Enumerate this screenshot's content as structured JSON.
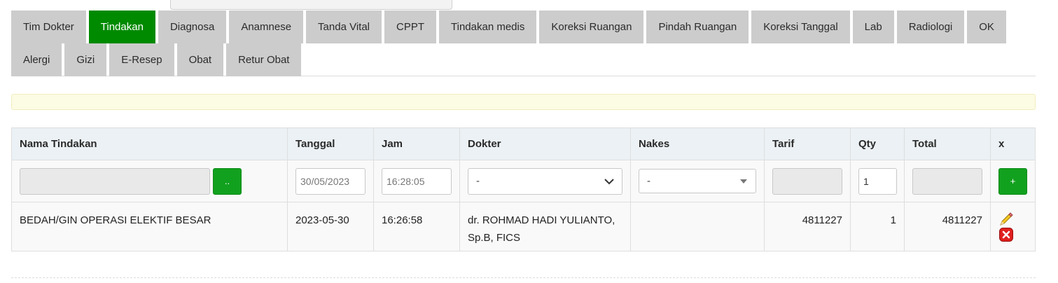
{
  "tabs_row1": [
    "Tim Dokter",
    "Tindakan",
    "Diagnosa",
    "Anamnese",
    "Tanda Vital",
    "CPPT",
    "Tindakan medis",
    "Koreksi Ruangan",
    "Pindah Ruangan",
    "Koreksi Tanggal",
    "Lab",
    "Radiologi",
    "OK"
  ],
  "tabs_row2": [
    "Alergi",
    "Gizi",
    "E-Resep",
    "Obat",
    "Retur Obat"
  ],
  "active_tab": "Tindakan",
  "table": {
    "headers": {
      "nama": "Nama Tindakan",
      "tanggal": "Tanggal",
      "jam": "Jam",
      "dokter": "Dokter",
      "nakes": "Nakes",
      "tarif": "Tarif",
      "qty": "Qty",
      "total": "Total",
      "x": "x"
    },
    "input_row": {
      "nama_value": "",
      "lookup_label": "..",
      "tanggal_value": "30/05/2023",
      "jam_value": "16:28:05",
      "dokter_selected": "-",
      "nakes_selected": "-",
      "tarif_value": "",
      "qty_value": "1",
      "total_value": "",
      "add_label": "+"
    },
    "rows": [
      {
        "nama": "BEDAH/GIN OPERASI ELEKTIF BESAR",
        "tanggal": "2023-05-30",
        "jam": "16:26:58",
        "dokter": "dr. ROHMAD HADI YULIANTO, Sp.B, FICS",
        "nakes": "",
        "tarif": "4811227",
        "qty": "1",
        "total": "4811227"
      }
    ]
  },
  "colors": {
    "active_tab": "#008a00",
    "tab": "#cccccc",
    "header_bg": "#ebf1f4",
    "notice_bg": "#fcfbe3",
    "button_green": "#12a11f"
  },
  "icons": [
    "pencil-icon",
    "delete-icon",
    "chevron-down-icon"
  ]
}
